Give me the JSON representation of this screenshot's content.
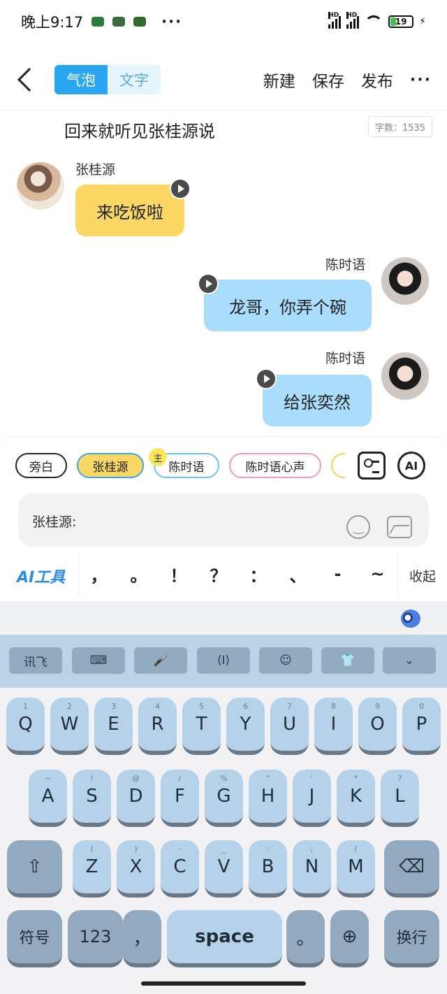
{
  "status": {
    "time": "晚上9:17",
    "dots": "···",
    "battery": "19",
    "hd1": "HD",
    "hd2": "HD"
  },
  "header": {
    "mode_bubble": "气泡",
    "mode_text": "文字",
    "new_label": "新建",
    "save_label": "保存",
    "publish_label": "发布",
    "more_label": "···"
  },
  "story": {
    "title": "回来就听见张桂源说",
    "word_count": "字数：1535"
  },
  "messages": [
    {
      "speaker": "张桂源",
      "text": "来吃饭啦",
      "side": "left",
      "color": "#fbd866"
    },
    {
      "speaker": "陈时语",
      "text": "龙哥，你弄个碗",
      "side": "right",
      "color": "#a9ddfb"
    },
    {
      "speaker": "陈时语",
      "text": "给张奕然",
      "side": "right",
      "color": "#a9ddfb"
    }
  ],
  "characters": {
    "items": [
      "旁白",
      "张桂源",
      "陈时语",
      "陈时语心声"
    ],
    "host_badge": "主",
    "selected": "张桂源"
  },
  "ai_icon_label": "AI",
  "input": {
    "label": "张桂源:"
  },
  "tools": {
    "ai_tools": "AI工具",
    "punctuation": [
      "，",
      "。",
      "！",
      "？",
      "：",
      "、",
      "-",
      "~"
    ],
    "collapse": "收起"
  },
  "keyboard": {
    "toolbar": [
      "讯飞",
      "⌨",
      "🎤",
      "⟨I⟩",
      "☺",
      "👕",
      "⌄"
    ],
    "row1": [
      [
        "Q",
        "1"
      ],
      [
        "W",
        "2"
      ],
      [
        "E",
        "3"
      ],
      [
        "R",
        "4"
      ],
      [
        "T",
        "5"
      ],
      [
        "Y",
        "6"
      ],
      [
        "U",
        "7"
      ],
      [
        "I",
        "8"
      ],
      [
        "O",
        "9"
      ],
      [
        "P",
        "0"
      ]
    ],
    "row2": [
      [
        "A",
        "~"
      ],
      [
        "S",
        "!"
      ],
      [
        "D",
        "@"
      ],
      [
        "F",
        "/"
      ],
      [
        "G",
        "%"
      ],
      [
        "H",
        "\""
      ],
      [
        "J",
        "'"
      ],
      [
        "K",
        "*"
      ],
      [
        "L",
        "?"
      ]
    ],
    "row3": [
      [
        "Z",
        "("
      ],
      [
        "X",
        ")"
      ],
      [
        "C",
        "-"
      ],
      [
        "V",
        "_"
      ],
      [
        "B",
        ":"
      ],
      [
        "N",
        ";"
      ],
      [
        "M",
        "/"
      ]
    ],
    "symbols": "符号",
    "numbers": "123",
    "comma": "，",
    "space": "space",
    "period": "。",
    "enter": "换行"
  }
}
